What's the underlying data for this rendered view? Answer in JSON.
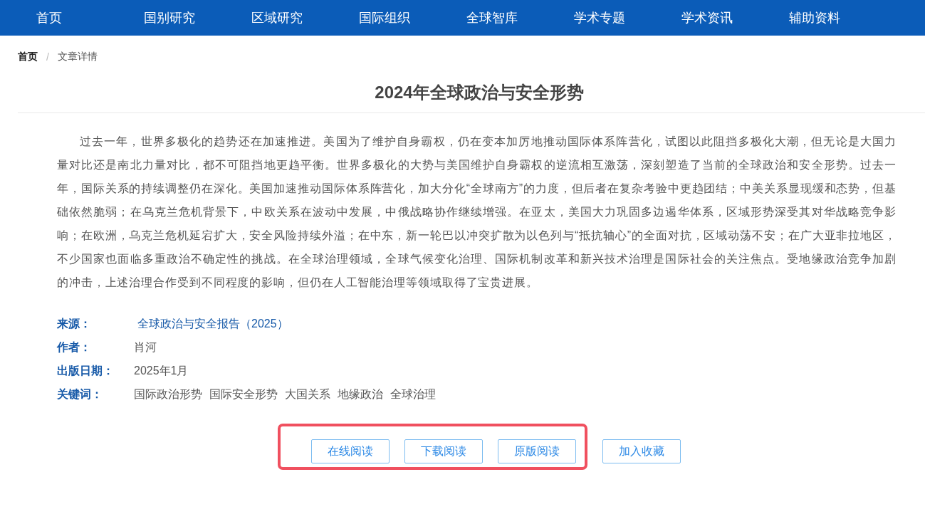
{
  "nav": [
    {
      "label": "首页",
      "selected": false
    },
    {
      "label": "国别研究",
      "selected": false
    },
    {
      "label": "区域研究",
      "selected": false
    },
    {
      "label": "国际组织",
      "selected": false
    },
    {
      "label": "全球智库",
      "selected": false
    },
    {
      "label": "学术专题",
      "selected": false
    },
    {
      "label": "学术资讯",
      "selected": false
    },
    {
      "label": "辅助资料",
      "selected": false
    }
  ],
  "breadcrumb": [
    "首页",
    "文章详情"
  ],
  "breadcrumb_separator": "/",
  "title": "2024年全球政治与安全形势",
  "abstract": "过去一年，世界多极化的趋势还在加速推进。美国为了维护自身霸权，仍在变本加厉地推动国际体系阵营化，试图以此阻挡多极化大潮，但无论是大国力量对比还是南北力量对比，都不可阻挡地更趋平衡。世界多极化的大势与美国维护自身霸权的逆流相互激荡，深刻塑造了当前的全球政治和安全形势。过去一年，国际关系的持续调整仍在深化。美国加速推动国际体系阵营化，加大分化“全球南方”的力度，但后者在复杂考验中更趋团结；中美关系显现缓和态势，但基础依然脆弱；在乌克兰危机背景下，中欧关系在波动中发展，中俄战略协作继续增强。在亚太，美国大力巩固多边遏华体系，区域形势深受其对华战略竞争影响；在欧洲，乌克兰危机延宕扩大，安全风险持续外溢；在中东，新一轮巴以冲突扩散为以色列与“抵抗轴心”的全面对抗，区域动荡不安；在广大亚非拉地区，不少国家也面临多重政治不确定性的挑战。在全球治理领域，全球气候变化治理、国际机制改革和新兴技术治理是国际社会的关注焦点。受地缘政治竞争加剧的冲击，上述治理合作受到不同程度的影响，但仍在人工智能治理等领域取得了宝贵进展。",
  "meta": [
    {
      "label": "来源：",
      "kind": "link",
      "values": [
        "全球政治与安全报告（2025）"
      ]
    },
    {
      "label": "作者：",
      "kind": "text",
      "values": [
        "肖河"
      ]
    },
    {
      "label": "出版日期：",
      "kind": "text",
      "values": [
        "2025年1月"
      ]
    },
    {
      "label": "关键词：",
      "kind": "text",
      "values": [
        "国际政治形势",
        "国际安全形势",
        "大国关系",
        "地缘政治",
        "全球治理"
      ]
    }
  ],
  "highlight_frame": {
    "buttons": [
      "在线阅读",
      "下载阅读",
      "原版阅读"
    ]
  },
  "buttons": [
    "加入收藏"
  ]
}
